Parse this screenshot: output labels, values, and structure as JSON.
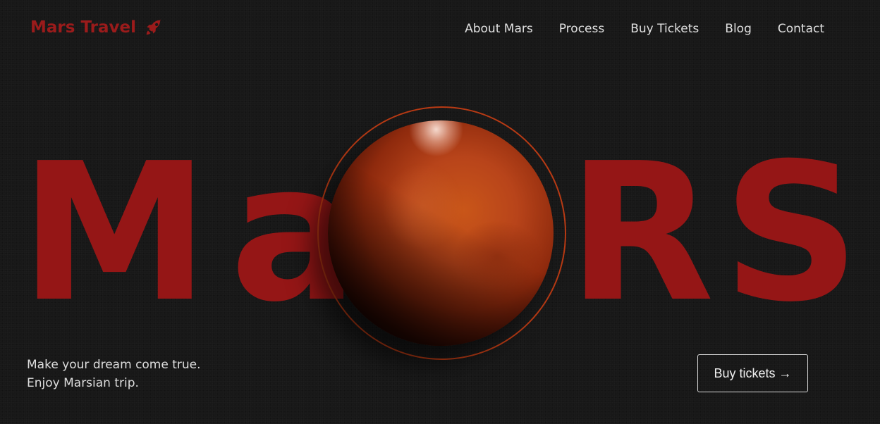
{
  "brand": {
    "name": "Mars Travel",
    "icon": "rocket-icon",
    "color": "#9b1b1b"
  },
  "nav": {
    "items": [
      {
        "label": "About Mars"
      },
      {
        "label": "Process"
      },
      {
        "label": "Buy Tickets"
      },
      {
        "label": "Blog"
      },
      {
        "label": "Contact"
      }
    ]
  },
  "hero": {
    "letters": [
      "M",
      "a",
      "R",
      "S"
    ],
    "accent_color": "#951616",
    "ring_color": "#b83a14",
    "tagline": {
      "line1": "Make your dream come true.",
      "line2": "Enjoy Marsian trip."
    },
    "cta_label": "Buy tickets →"
  }
}
